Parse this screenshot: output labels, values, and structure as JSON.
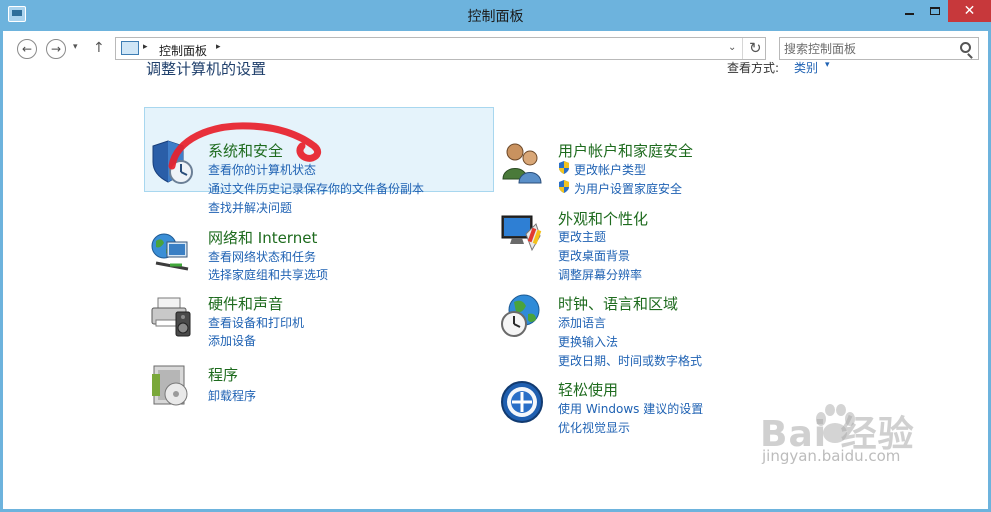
{
  "window": {
    "title": "控制面板"
  },
  "title_buttons": {
    "minimize": "最小化",
    "maximize": "最大化",
    "close": "✕"
  },
  "nav": {
    "back_glyph": "←",
    "forward_glyph": "→",
    "up_glyph": "↑",
    "drop_glyph": "▾",
    "sep_glyph": "▸"
  },
  "address": {
    "path": "控制面板",
    "drop_glyph": "⌄",
    "refresh_glyph": "↻"
  },
  "search": {
    "placeholder": "搜索控制面板"
  },
  "content": {
    "heading": "调整计算机的设置",
    "view_by_label": "查看方式:",
    "view_by_value": "类别",
    "caret": "▾"
  },
  "categories": [
    {
      "title": "系统和安全",
      "icon": "shield-clock-icon",
      "links": [
        "查看你的计算机状态",
        "通过文件历史记录保存你的文件备份副本",
        "查找并解决问题"
      ]
    },
    {
      "title": "网络和 Internet",
      "icon": "network-globe-icon",
      "links": [
        "查看网络状态和任务",
        "选择家庭组和共享选项"
      ]
    },
    {
      "title": "硬件和声音",
      "icon": "printer-speaker-icon",
      "links": [
        "查看设备和打印机",
        "添加设备"
      ]
    },
    {
      "title": "程序",
      "icon": "programs-box-icon",
      "links": [
        "卸载程序"
      ]
    },
    {
      "title": "用户帐户和家庭安全",
      "icon": "users-icon",
      "links": [
        "更改帐户类型",
        "为用户设置家庭安全"
      ]
    },
    {
      "title": "外观和个性化",
      "icon": "monitor-palette-icon",
      "links": [
        "更改主题",
        "更改桌面背景",
        "调整屏幕分辨率"
      ]
    },
    {
      "title": "时钟、语言和区域",
      "icon": "globe-clock-icon",
      "links": [
        "添加语言",
        "更换输入法",
        "更改日期、时间或数字格式"
      ]
    },
    {
      "title": "轻松使用",
      "icon": "ease-of-access-icon",
      "links": [
        "使用 Windows 建议的设置",
        "优化视觉显示"
      ]
    }
  ],
  "watermark": {
    "logo": "Bai  经验",
    "url": "jingyan.baidu.com"
  },
  "colors": {
    "titlebar": "#6db3dd",
    "category_title": "#1e6b1e",
    "link": "#1f62b3",
    "heading": "#1f3f6b",
    "close": "#c7383b",
    "annotation": "#e8202a"
  }
}
